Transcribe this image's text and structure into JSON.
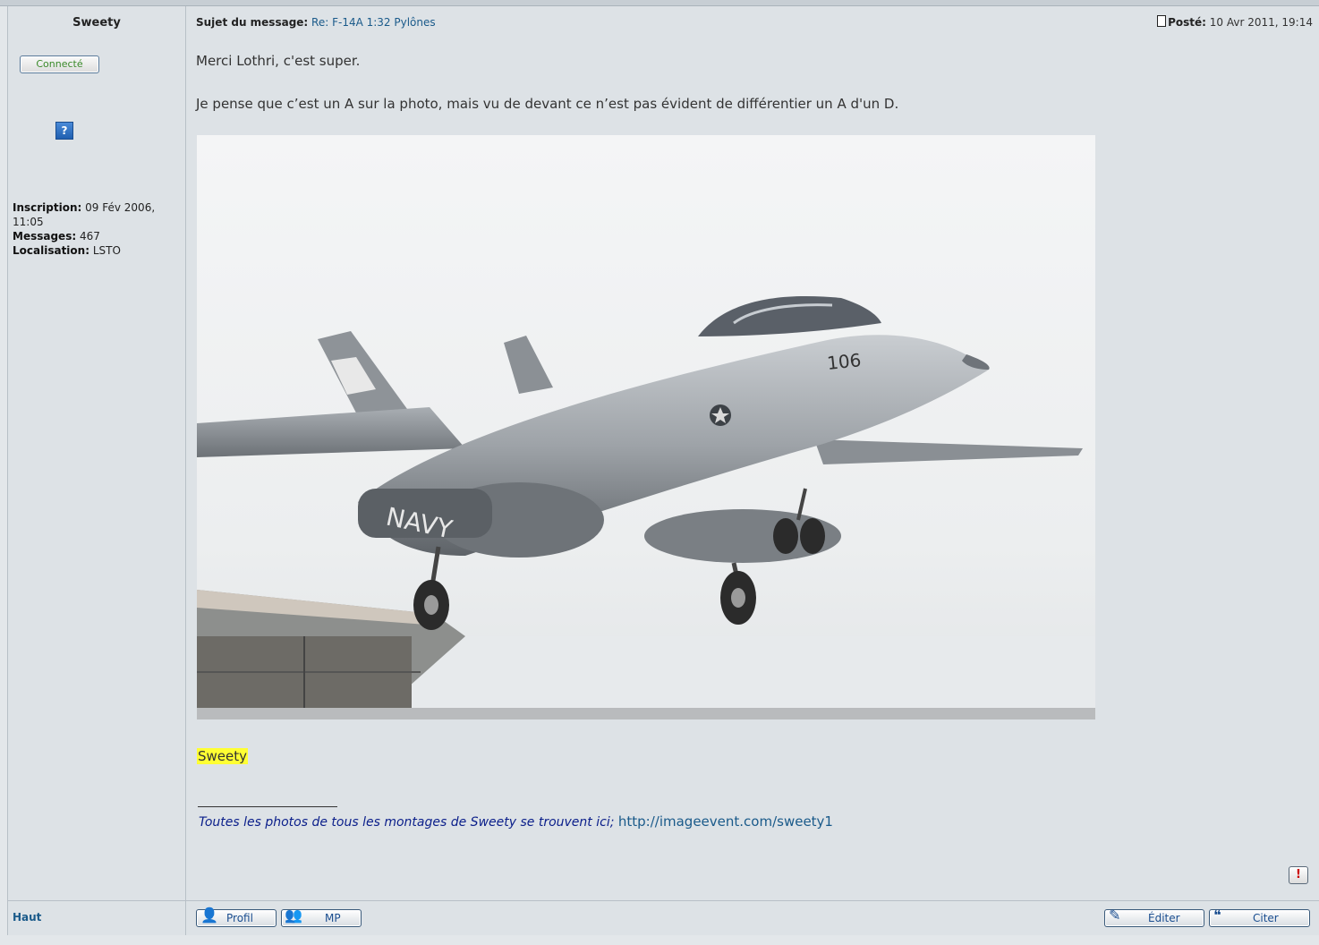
{
  "post": {
    "author": "Sweety",
    "online_label": "Connecté",
    "rank_icon": "?",
    "profile": {
      "inscription_label": "Inscription:",
      "inscription_value": "09 Fév 2006, 11:05",
      "messages_label": "Messages:",
      "messages_value": "467",
      "localisation_label": "Localisation:",
      "localisation_value": "LSTO"
    },
    "subject_label": "Sujet du message:",
    "subject_value": "Re: F-14A 1:32 Pylônes",
    "posted_label": "Posté:",
    "posted_value": "10 Avr 2011, 19:14",
    "body_line1": "Merci Lothri, c'est super.",
    "body_line2": "Je pense que c’est un A sur la photo, mais vu de devant ce n’est pas évident de différentier un A d'un D.",
    "signature_name": "Sweety",
    "signature_text": "Toutes les photos de tous les montages de Sweety se trouvent ici",
    "signature_sep": ";",
    "signature_url": "http://imageevent.com/sweety1",
    "report_label": "!"
  },
  "footer": {
    "top_link": "Haut",
    "profile_button": "Profil",
    "pm_button": "MP",
    "edit_button": "Éditer",
    "quote_button": "Citer"
  }
}
